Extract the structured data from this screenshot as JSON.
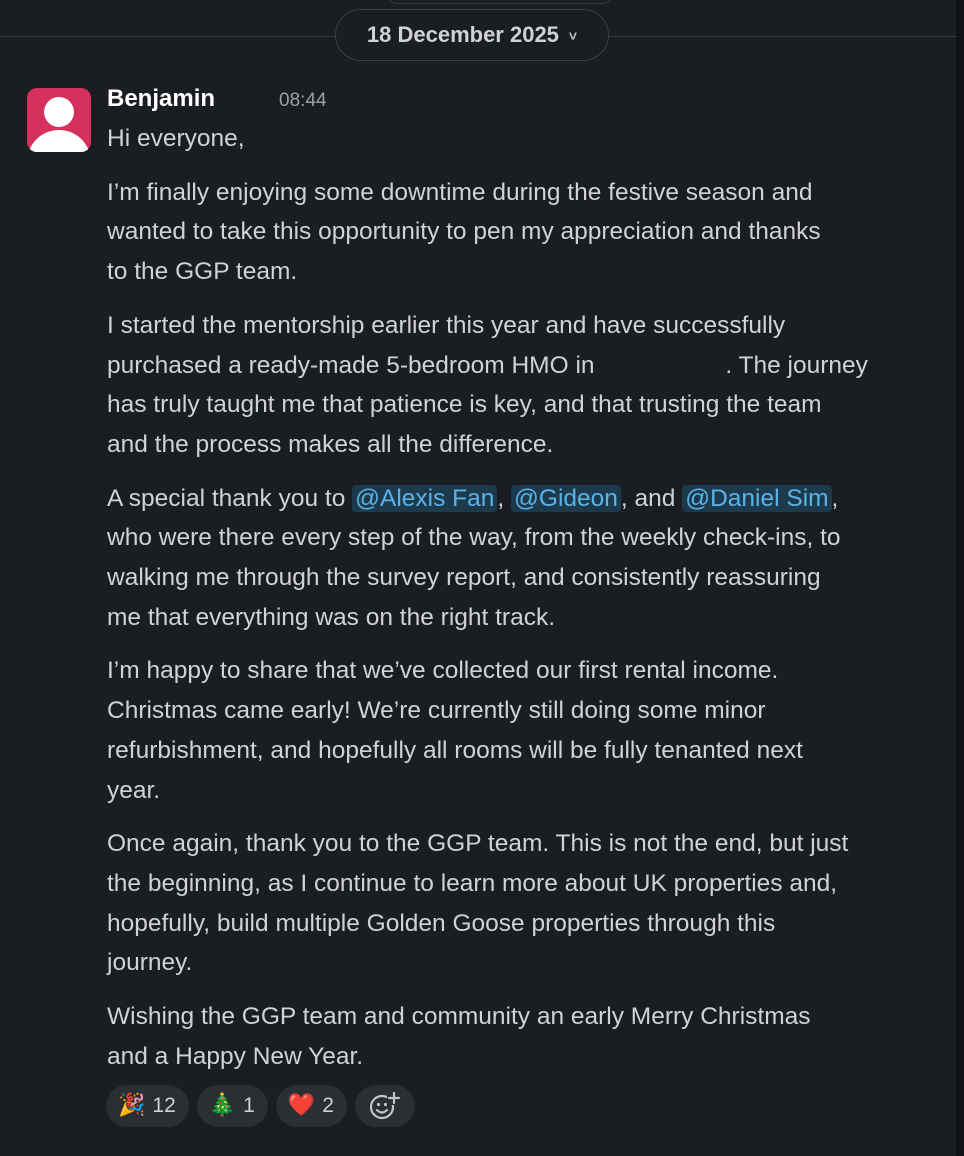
{
  "date_divider": {
    "label": "18 December 2025",
    "chevron": "˅"
  },
  "message": {
    "author": "Benjamin",
    "time": "08:44",
    "avatar_color": "#d6305d",
    "avatar_icon": "user-silhouette-icon",
    "lines": {
      "p1": "Hi everyone,",
      "p2a": "I’m finally enjoying some downtime during the festive season and",
      "p2b": "wanted to take this opportunity to pen my appreciation and thanks",
      "p2c": "to the GGP team.",
      "p3a": "I started the mentorship earlier this year and have successfully",
      "p3b_before": "purchased a ready-made 5-bedroom HMO in ",
      "p3b_after": ". The journey",
      "p3c": "has truly taught me that patience is key, and that trusting the team",
      "p3d": "and the process makes all the difference.",
      "p4a_prefix": "A special thank you to ",
      "mention1": "@Alexis Fan",
      "sep1": ", ",
      "mention2": "@Gideon",
      "sep2": ", and ",
      "mention3": "@Daniel Sim",
      "sep3": ",",
      "p4b": "who were there every step of the way, from the weekly check-ins, to",
      "p4c": "walking me through the survey report, and consistently reassuring",
      "p4d": "me that everything was on the right track.",
      "p5a": "I’m happy to share that we’ve collected our first rental income.",
      "p5b": "Christmas came early! We’re currently still doing some minor",
      "p5c": "refurbishment, and hopefully all rooms will be fully tenanted next",
      "p5d": "year.",
      "p6a": "Once again, thank you to the GGP team. This is not the end, but just",
      "p6b": "the beginning, as I continue to learn more about UK properties and,",
      "p6c": "hopefully, build multiple Golden Goose properties through this",
      "p6d": "journey.",
      "p7a": "Wishing the GGP team and community an early Merry Christmas",
      "p7b": "and a Happy New Year."
    },
    "mention_color": "#5ab3e8"
  },
  "reactions": [
    {
      "emoji": "🎉",
      "icon": "party-popper-icon",
      "count": "12"
    },
    {
      "emoji": "🎄",
      "icon": "christmas-tree-icon",
      "count": "1"
    },
    {
      "emoji": "❤️",
      "icon": "red-heart-icon",
      "count": "2"
    }
  ],
  "add_reaction_icon": "add-reaction-icon"
}
